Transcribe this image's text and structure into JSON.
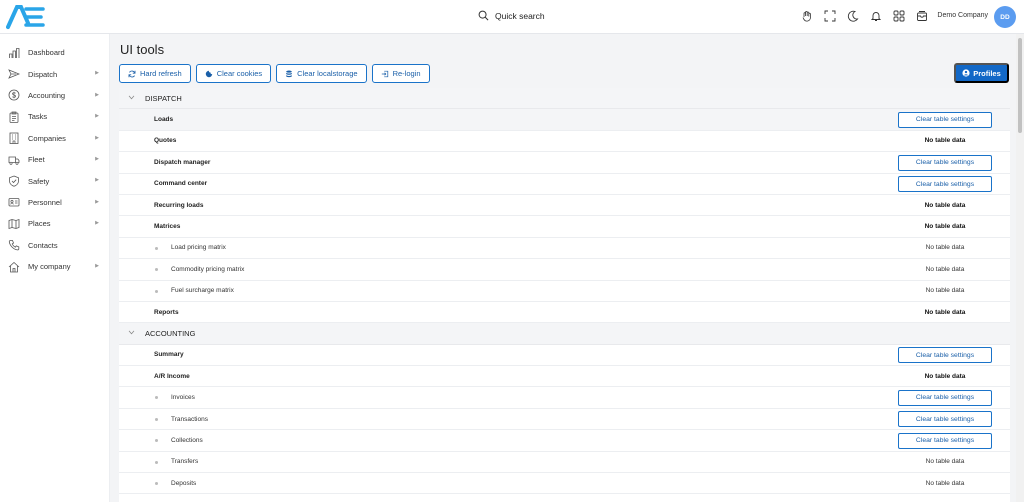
{
  "header": {
    "search_label": "Quick search",
    "company": "Demo Company",
    "avatar_initials": "DD",
    "icons": [
      "hand-icon",
      "fullscreen-icon",
      "moon-icon",
      "bell-icon",
      "grid-icon",
      "inbox-icon"
    ]
  },
  "sidebar": {
    "items": [
      {
        "label": "Dashboard",
        "icon": "chart-icon",
        "chevron": false
      },
      {
        "label": "Dispatch",
        "icon": "send-icon",
        "chevron": true
      },
      {
        "label": "Accounting",
        "icon": "dollar-icon",
        "chevron": true
      },
      {
        "label": "Tasks",
        "icon": "clipboard-icon",
        "chevron": true
      },
      {
        "label": "Companies",
        "icon": "building-icon",
        "chevron": true
      },
      {
        "label": "Fleet",
        "icon": "truck-icon",
        "chevron": true
      },
      {
        "label": "Safety",
        "icon": "shield-icon",
        "chevron": true
      },
      {
        "label": "Personnel",
        "icon": "id-card-icon",
        "chevron": true
      },
      {
        "label": "Places",
        "icon": "map-icon",
        "chevron": true
      },
      {
        "label": "Contacts",
        "icon": "phone-icon",
        "chevron": false
      },
      {
        "label": "My company",
        "icon": "home-icon",
        "chevron": true
      }
    ]
  },
  "main": {
    "title": "UI tools",
    "toolbar": {
      "hard_refresh": "Hard refresh",
      "clear_cookies": "Clear cookies",
      "clear_localstorage": "Clear localstorage",
      "relogin": "Re-login"
    },
    "profiles": "Profiles",
    "clear_label": "Clear table settings",
    "no_data_label": "No table data",
    "sections": [
      {
        "title": "DISPATCH",
        "rows": [
          {
            "label": "Loads",
            "sub": false,
            "clearable": true
          },
          {
            "label": "Quotes",
            "sub": false,
            "clearable": false
          },
          {
            "label": "Dispatch manager",
            "sub": false,
            "clearable": true
          },
          {
            "label": "Command center",
            "sub": false,
            "clearable": true
          },
          {
            "label": "Recurring loads",
            "sub": false,
            "clearable": false
          },
          {
            "label": "Matrices",
            "sub": false,
            "clearable": false
          },
          {
            "label": "Load pricing matrix",
            "sub": true,
            "clearable": false
          },
          {
            "label": "Commodity pricing matrix",
            "sub": true,
            "clearable": false
          },
          {
            "label": "Fuel surcharge matrix",
            "sub": true,
            "clearable": false
          },
          {
            "label": "Reports",
            "sub": false,
            "clearable": false
          }
        ]
      },
      {
        "title": "ACCOUNTING",
        "rows": [
          {
            "label": "Summary",
            "sub": false,
            "clearable": true
          },
          {
            "label": "A/R Income",
            "sub": false,
            "clearable": false
          },
          {
            "label": "Invoices",
            "sub": true,
            "clearable": true
          },
          {
            "label": "Transactions",
            "sub": true,
            "clearable": true
          },
          {
            "label": "Collections",
            "sub": true,
            "clearable": true
          },
          {
            "label": "Transfers",
            "sub": true,
            "clearable": false
          },
          {
            "label": "Deposits",
            "sub": true,
            "clearable": false
          }
        ]
      }
    ]
  }
}
